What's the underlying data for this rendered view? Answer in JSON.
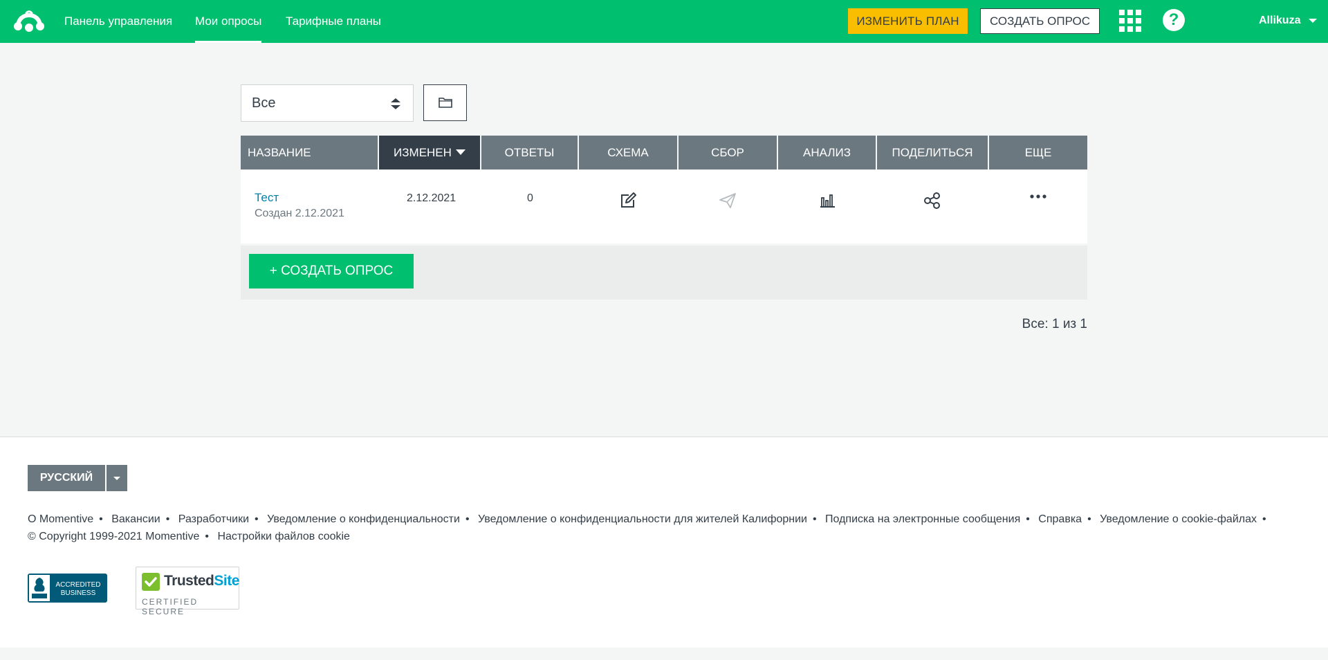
{
  "header": {
    "nav": [
      "Панель управления",
      "Мои опросы",
      "Тарифные планы"
    ],
    "active_nav": "Мои опросы",
    "upgrade_label": "ИЗМЕНИТЬ ПЛАН",
    "create_label": "СОЗДАТЬ ОПРОС",
    "help_label": "?",
    "username": "Allikuza"
  },
  "filter": {
    "selected": "Все"
  },
  "table": {
    "columns": [
      "НАЗВАНИЕ",
      "ИЗМЕНЕН",
      "ОТВЕТЫ",
      "СХЕМА",
      "СБОР",
      "АНАЛИЗ",
      "ПОДЕЛИТЬСЯ",
      "ЕЩЕ"
    ],
    "sorted_column": "ИЗМЕНЕН",
    "rows": [
      {
        "title": "Тест",
        "created": "Создан 2.12.2021",
        "modified": "2.12.2021",
        "responses": "0",
        "icons": [
          "edit-icon",
          "send-icon",
          "bar-chart-icon",
          "share-icon",
          "more-icon"
        ]
      }
    ],
    "create_label": "+ СОЗДАТЬ ОПРОС"
  },
  "pager": "Все: 1 из 1",
  "footer": {
    "language": "РУССКИЙ",
    "links_line1": [
      "О Momentive",
      "Вакансии",
      "Разработчики",
      "Уведомление о конфиденциальности",
      "Уведомление о конфиденциальности для жителей Калифорнии",
      "Подписка на электронные сообщения",
      "Справка",
      "Уведомление о cookie-файлах"
    ],
    "links_line2": [
      "© Copyright 1999-2021 Momentive",
      "Настройки файлов cookie"
    ],
    "bbb_line1": "ACCREDITED",
    "bbb_line2": "BUSINESS",
    "trusted_title_a": "Trusted",
    "trusted_title_b": "Site",
    "trusted_sub": "CERTIFIED SECURE"
  },
  "colors": {
    "brand_green": "#00bf6f",
    "upgrade_yellow": "#f9be00",
    "header_gray": "#6b787f",
    "sorted_dark": "#333e48",
    "link_blue": "#007faa"
  }
}
